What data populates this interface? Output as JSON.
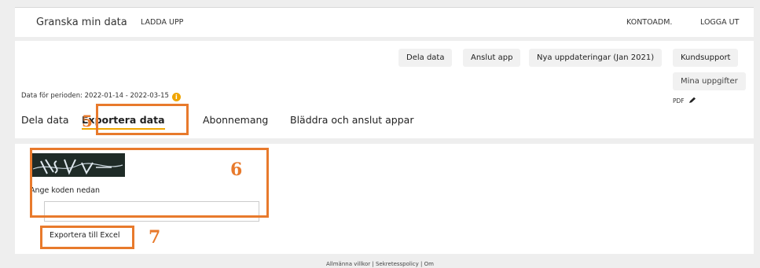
{
  "topbar": {
    "brand": "Granska min data",
    "upload": "LADDA UPP",
    "account": "KONTOADM.",
    "logout": "LOGGA UT"
  },
  "actions": {
    "share": "Dela data",
    "connect": "Anslut app",
    "updates": "Nya uppdateringar (Jan 2021)",
    "support": "Kundsupport",
    "my_info": "Mina uppgifter"
  },
  "period": "Data för perioden: 2022-01-14 - 2022-03-15",
  "pdf_label": "PDF",
  "tabs": [
    {
      "label": "Dela data",
      "active": false
    },
    {
      "label": "Exportera data",
      "active": true
    },
    {
      "label": "Abonnemang",
      "active": false
    },
    {
      "label": "Bläddra och anslut appar",
      "active": false
    }
  ],
  "callouts": {
    "tab": "5",
    "captcha": "6",
    "export": "7"
  },
  "export": {
    "code_label": "Ange koden nedan",
    "code_value": "",
    "button": "Exportera till Excel"
  },
  "footer": {
    "terms": "Allmänna villkor",
    "privacy": "Sekretesspolicy",
    "about": "Om",
    "separator": "|"
  },
  "colors": {
    "accent": "#f0a500",
    "callout": "#e87a2c",
    "page_bg": "#eeeeee",
    "card_bg": "#ffffff",
    "button_bg": "#f1f1f1"
  },
  "icons": [
    "info-icon",
    "edit-icon",
    "captcha-image"
  ]
}
